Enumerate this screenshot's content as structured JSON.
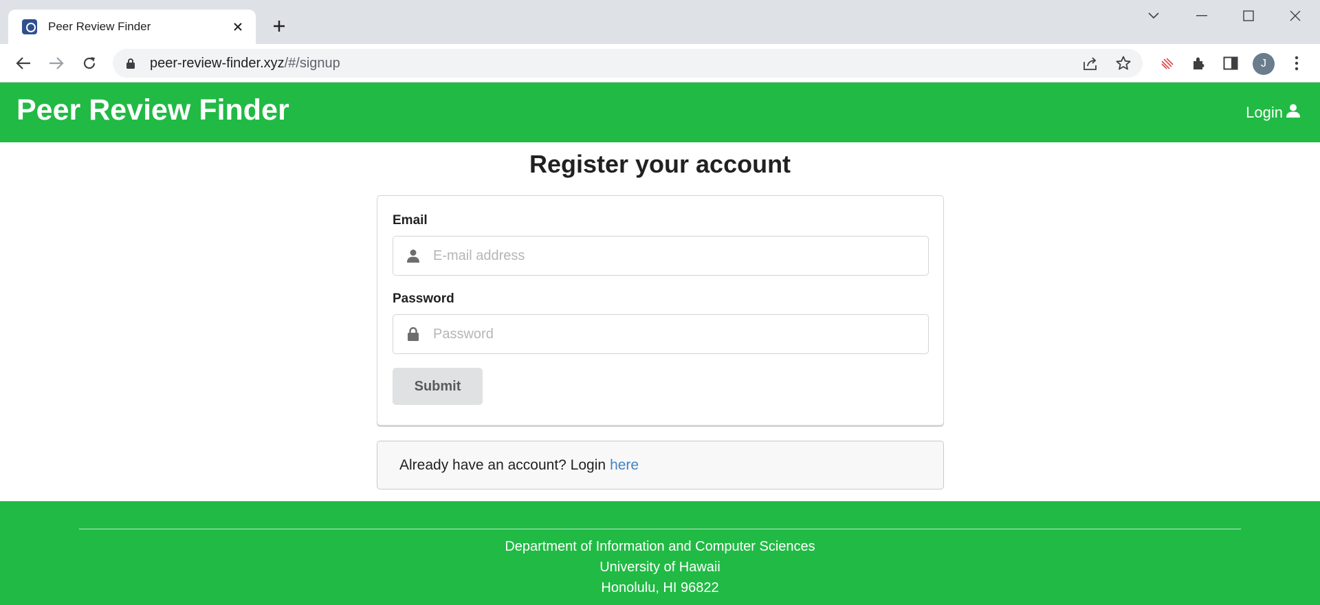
{
  "browser": {
    "tab_title": "Peer Review Finder",
    "url_host": "peer-review-finder.xyz",
    "url_path": "/#/signup",
    "profile_initial": "J"
  },
  "navbar": {
    "brand": "Peer Review Finder",
    "login_label": "Login"
  },
  "page": {
    "title": "Register your account"
  },
  "form": {
    "email_label": "Email",
    "email_placeholder": "E-mail address",
    "email_value": "",
    "password_label": "Password",
    "password_placeholder": "Password",
    "password_value": "",
    "submit_label": "Submit"
  },
  "message": {
    "text": "Already have an account? Login",
    "link_label": "here"
  },
  "footer": {
    "line1": "Department of Information and Computer Sciences",
    "line2": "University of Hawaii",
    "line3": "Honolulu, HI 96822"
  },
  "colors": {
    "brand_green": "#21ba45",
    "link_blue": "#4183c4",
    "button_gray": "#e0e1e2"
  }
}
